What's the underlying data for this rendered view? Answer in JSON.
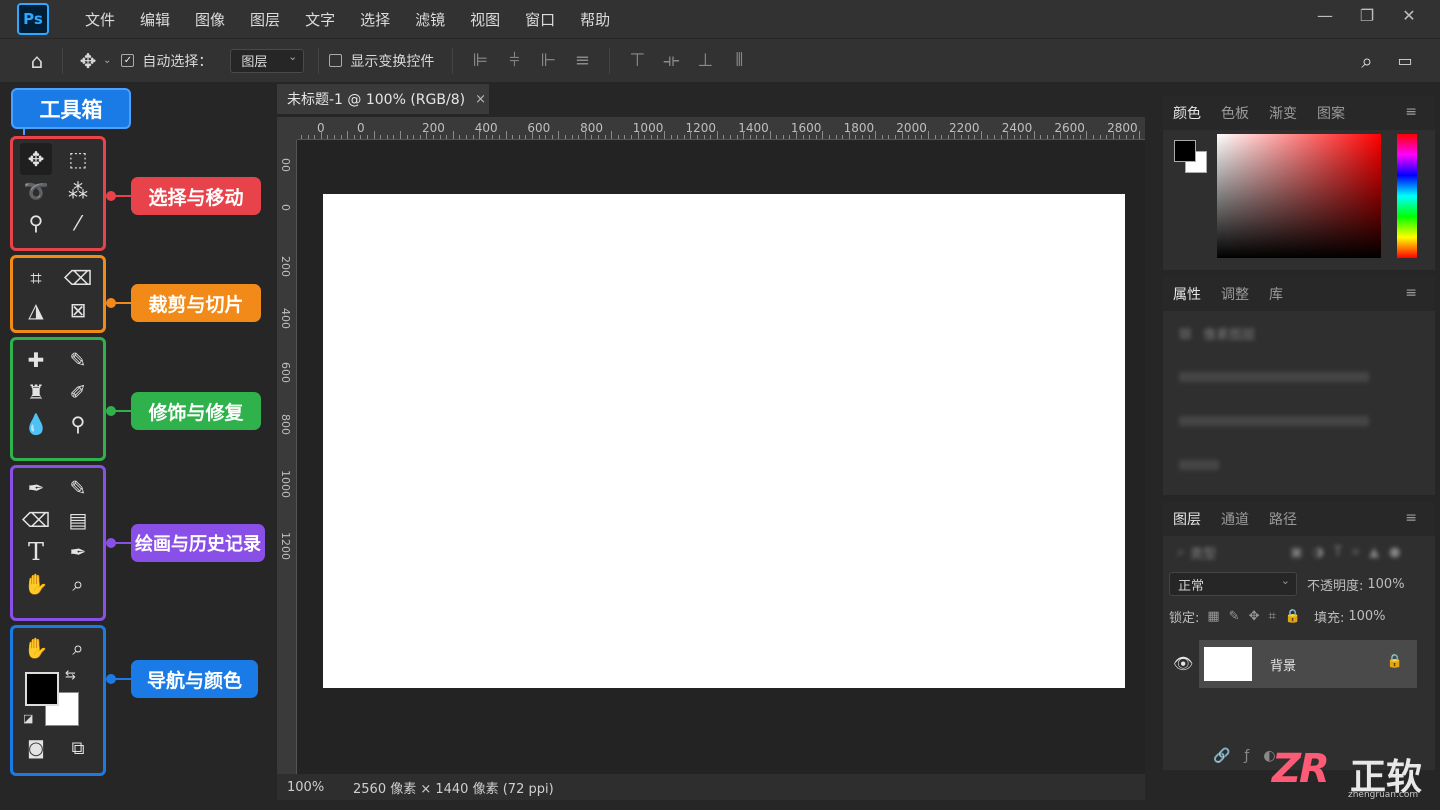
{
  "app": {
    "logo": "Ps",
    "menu": [
      "文件",
      "编辑",
      "图像",
      "图层",
      "文字",
      "选择",
      "滤镜",
      "视图",
      "窗口",
      "帮助"
    ]
  },
  "options_bar": {
    "auto_select_label": "自动选择：",
    "auto_select_checked": true,
    "auto_select_value": "图层",
    "show_transform_label": "显示变换控件",
    "show_transform_checked": false
  },
  "toolbox": {
    "title": "工具箱",
    "groups": [
      {
        "label": "选择与移动",
        "color": "#e8434a"
      },
      {
        "label": "裁剪与切片",
        "color": "#f28a1a"
      },
      {
        "label": "修饰与修复",
        "color": "#2fb24c"
      },
      {
        "label": "绘画与历史记录",
        "color": "#8a4fe6"
      },
      {
        "label": "导航与颜色",
        "color": "#1a7be6"
      }
    ]
  },
  "document": {
    "tab_title": "未标题-1 @ 100% (RGB/8)",
    "close": "×",
    "ruler_h_labels": [
      "0",
      "0",
      "200",
      "400",
      "600",
      "800",
      "1000",
      "1200",
      "1400",
      "1600",
      "1800",
      "2000",
      "2200",
      "2400",
      "2600",
      "2800"
    ],
    "ruler_v_labels": [
      "00",
      "0",
      "200",
      "400",
      "600",
      "800",
      "1000",
      "1200"
    ],
    "zoom": "100%",
    "doc_info": "2560 像素 × 1440 像素 (72 ppi)"
  },
  "panels": {
    "color_tabs": [
      "颜色",
      "色板",
      "渐变",
      "图案"
    ],
    "properties_tabs": [
      "属性",
      "调整",
      "库"
    ],
    "properties_title": "像素图层",
    "layers_tabs": [
      "图层",
      "通道",
      "路径"
    ],
    "layer_filter_placeholder": "类型",
    "blend_mode": "正常",
    "opacity_label": "不透明度:",
    "opacity_value": "100%",
    "lock_label": "锁定:",
    "fill_label": "填充:",
    "fill_value": "100%",
    "layer_name": "背景"
  },
  "watermark": {
    "logo": "ZR",
    "name": "正软",
    "url": "zhengruan.com"
  }
}
